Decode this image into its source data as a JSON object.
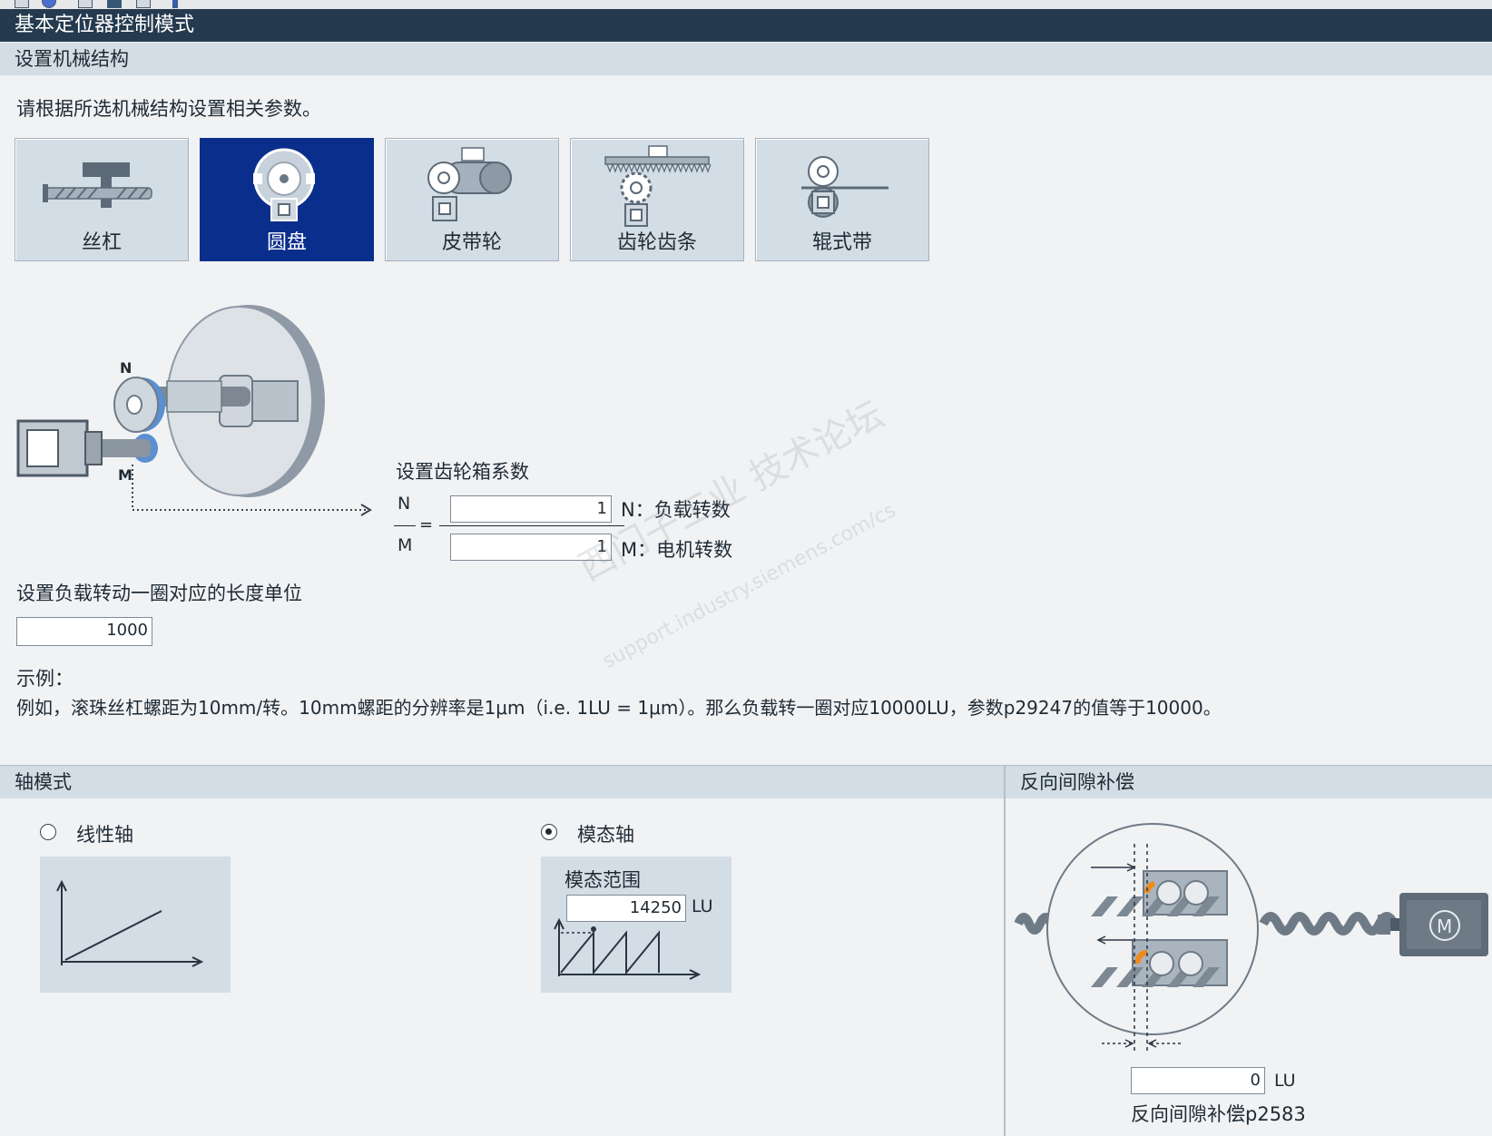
{
  "window": {
    "title": "基本定位器控制模式"
  },
  "mechanics": {
    "header": "设置机械结构",
    "instruction": "请根据所选机械结构设置相关参数。",
    "options": [
      {
        "label": "丝杠",
        "icon": "leadscrew-icon"
      },
      {
        "label": "圆盘",
        "icon": "rotary-table-icon",
        "selected": true
      },
      {
        "label": "皮带轮",
        "icon": "belt-pulley-icon"
      },
      {
        "label": "齿轮齿条",
        "icon": "rack-pinion-icon"
      },
      {
        "label": "辊式带",
        "icon": "roller-belt-icon"
      }
    ],
    "selected": "圆盘"
  },
  "diagram": {
    "label_n": "N",
    "label_m": "M"
  },
  "gearbox": {
    "title": "设置齿轮箱系数",
    "n_label": "N",
    "m_label": "M",
    "equals": "=",
    "n_value": "1",
    "m_value": "1",
    "n_desc": "N：负载转数",
    "m_desc": "M：电机转数"
  },
  "length_unit": {
    "label": "设置负载转动一圈对应的长度单位",
    "value": "1000"
  },
  "example": {
    "heading": "示例：",
    "text": "例如，滚珠丝杠螺距为10mm/转。10mm螺距的分辨率是1μm（i.e. 1LU = 1μm）。那么负载转一圈对应10000LU，参数p29247的值等于10000。"
  },
  "watermark": {
    "line1": "西门子工业 技术论坛",
    "line2": "support.industry.siemens.com/cs"
  },
  "axis_mode": {
    "header": "轴模式",
    "linear_label": "线性轴",
    "linear_selected": false,
    "modulo_label": "模态轴",
    "modulo_selected": true,
    "modulo_range_label": "模态范围",
    "modulo_range_value": "14250",
    "modulo_unit": "LU"
  },
  "backlash": {
    "header": "反向间隙补偿",
    "value": "0",
    "unit": "LU",
    "caption": "反向间隙补偿p2583",
    "motor_label": "M"
  },
  "colors": {
    "title_bar": "#253a4e",
    "selected_button": "#0a2e8c",
    "section_header": "#d3dde6",
    "accent_orange": "#f08a1a"
  }
}
